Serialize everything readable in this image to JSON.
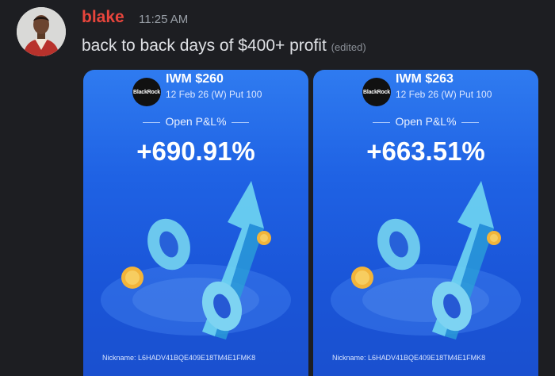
{
  "message": {
    "author": "blake",
    "time": "11:25 AM",
    "text": "back to back days of $400+ profit",
    "edited": "(edited)"
  },
  "cards": [
    {
      "logo": "BlackRock",
      "ticker": "IWM $260",
      "contract": "12 Feb 26 (W) Put 100",
      "pnl_label": "Open P&L%",
      "pnl_value": "+690.91%",
      "nickname": "Nickname: L6HADV41BQE409E18TM4E1FMK8"
    },
    {
      "logo": "BlackRock",
      "ticker": "IWM $263",
      "contract": "12 Feb 26 (W) Put 100",
      "pnl_label": "Open P&L%",
      "pnl_value": "+663.51%",
      "nickname": "Nickname: L6HADV41BQE409E18TM4E1FMK8"
    }
  ],
  "colors": {
    "author": "#e8453c",
    "background": "#1d1e22",
    "card": "#2169e6"
  }
}
